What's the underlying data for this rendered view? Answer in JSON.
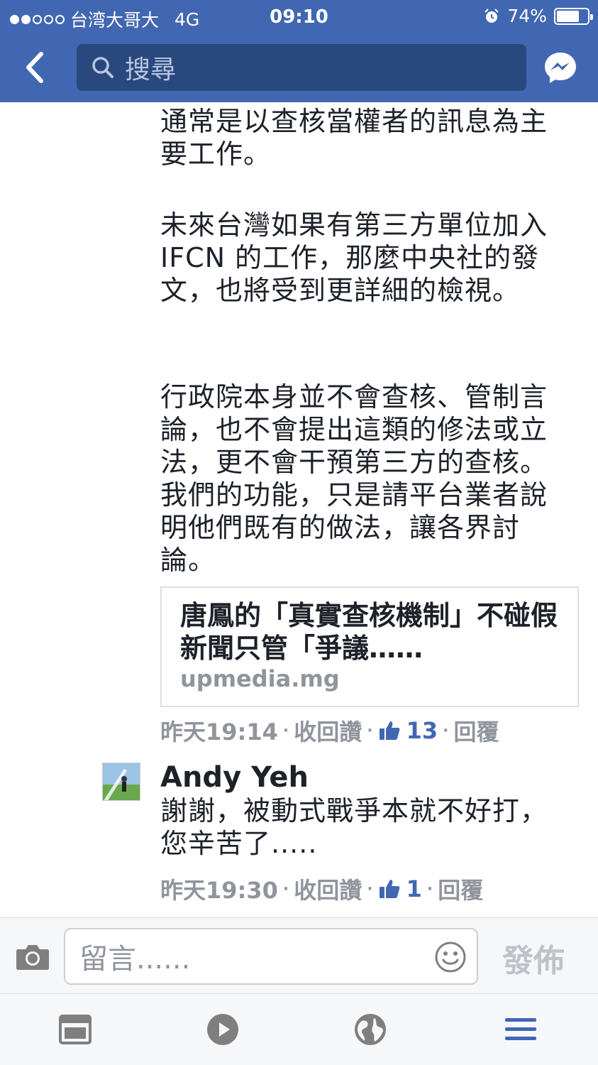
{
  "status_bar": {
    "carrier": "台湾大哥大",
    "network": "4G",
    "time": "09:10",
    "battery": "74%",
    "battery_level": 0.74
  },
  "nav": {
    "search_placeholder": "搜尋"
  },
  "post": {
    "paragraphs": [
      "通常是以查核當權者的訊息為主要工作。",
      "未來台灣如果有第三方單位加入 IFCN 的工作，那麼中央社的發文，也將受到更詳細的檢視。",
      "行政院本身並不會查核、管制言論，也不會提出這類的修法或立法，更不會干預第三方的查核。我們的功能，只是請平台業者說明他們既有的做法，讓各界討論。"
    ],
    "link": {
      "title": "唐鳳的「真實查核機制」不碰假新聞只管「爭議……",
      "domain": "upmedia.mg"
    },
    "meta": {
      "time": "昨天19:14",
      "unlike": "收回讚",
      "likes": "13",
      "reply": "回覆"
    }
  },
  "reply": {
    "author": "Andy Yeh",
    "text": "謝謝，被動式戰爭本就不好打，您辛苦了.....",
    "meta": {
      "time": "昨天19:30",
      "unlike": "收回讚",
      "likes": "1",
      "reply": "回覆"
    }
  },
  "composer": {
    "placeholder": "留言......",
    "post_label": "發佈"
  },
  "colors": {
    "brand": "#4267b2",
    "like_blue": "#4267b2",
    "meta_gray": "#90949c"
  },
  "icons": {
    "back": "chevron-left-icon",
    "search": "search-icon",
    "messenger": "messenger-icon",
    "camera": "camera-icon",
    "emoji": "emoji-icon",
    "like": "thumbs-up-icon",
    "tabs": [
      "news-feed-icon",
      "video-icon",
      "globe-icon",
      "menu-icon"
    ]
  }
}
